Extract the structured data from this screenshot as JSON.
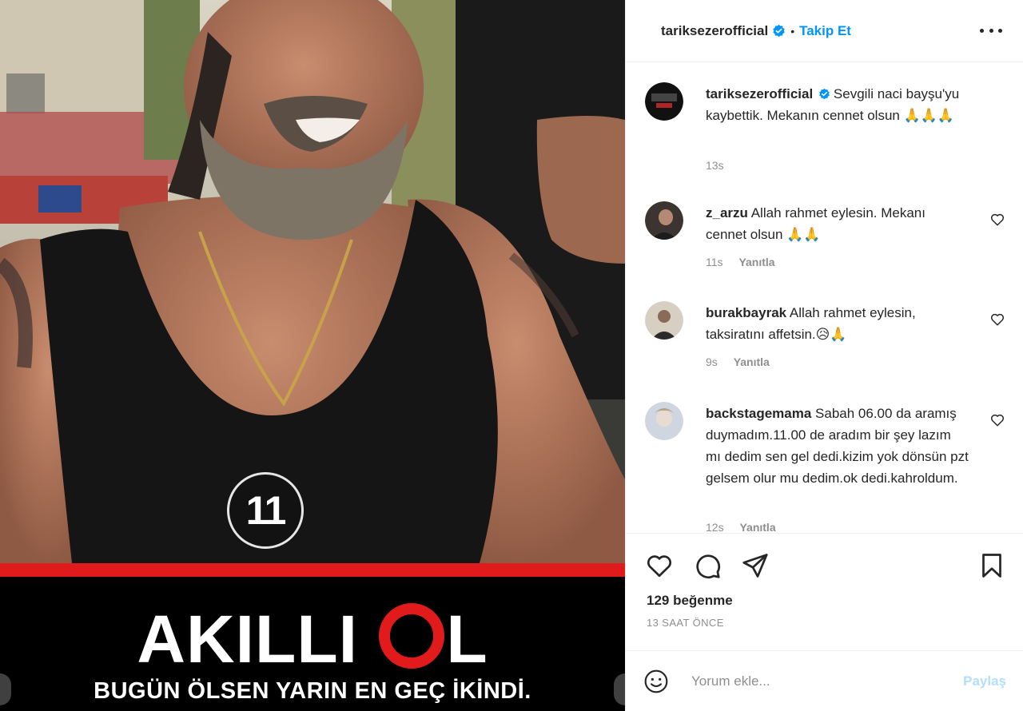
{
  "media": {
    "badge_number": "11",
    "banner_word_left": "AKILLI",
    "banner_word_right": "L",
    "banner_subtitle": "BUGÜN ÖLSEN YARIN EN GEÇ İKİNDİ.",
    "colors": {
      "accent_red": "#e11b1b",
      "banner_bg": "#000000"
    }
  },
  "header": {
    "username": "tariksezerofficial",
    "separator": "•",
    "follow_label": "Takip Et",
    "verified_icon": "verified-badge-icon",
    "more_icon": "more-options-icon"
  },
  "caption": {
    "username": "tariksezerofficial",
    "text": "Sevgili naci bayşu'yu kaybettik. Mekanın cennet olsun 🙏🙏🙏",
    "age": "13s"
  },
  "comments": [
    {
      "username": "z_arzu",
      "text": "Allah rahmet eylesin. Mekanı cennet olsun 🙏🙏",
      "age": "11s",
      "reply_label": "Yanıtla"
    },
    {
      "username": "burakbayrak",
      "text": "Allah rahmet eylesin, taksiratını affetsin.😥🙏",
      "age": "9s",
      "reply_label": "Yanıtla"
    },
    {
      "username": "backstagemama",
      "text": "Sabah 06.00 da aramış duymadım.11.00 de aradım bir şey lazım mı dedim sen gel dedi.kizim yok dönsün pzt gelsem olur mu dedim.ok dedi.kahroldum.",
      "age": "12s",
      "reply_label": "Yanıtla"
    }
  ],
  "actions": {
    "like_icon": "heart-icon",
    "comment_icon": "comment-bubble-icon",
    "share_icon": "paper-plane-icon",
    "save_icon": "bookmark-icon",
    "likes_text": "129 beğenme",
    "time_text": "13 SAAT ÖNCE"
  },
  "composer": {
    "placeholder": "Yorum ekle...",
    "post_label": "Paylaş",
    "emoji_icon": "emoji-icon"
  },
  "colors": {
    "link_blue": "#0095f6",
    "muted_gray": "#8e8e8e",
    "text": "#262626"
  }
}
